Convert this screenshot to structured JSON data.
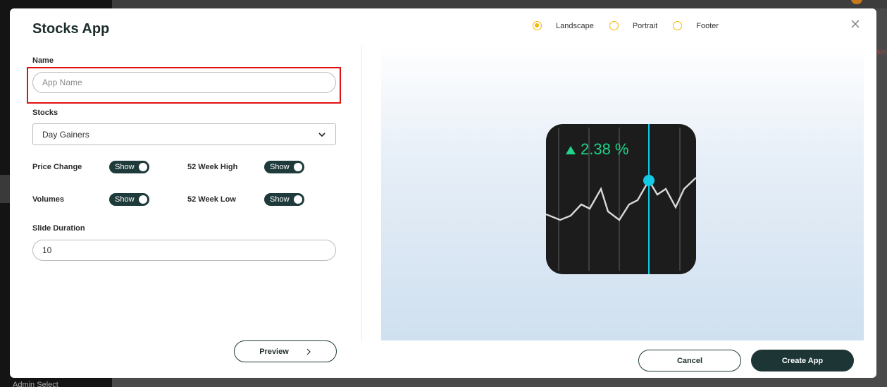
{
  "backdrop": {
    "right_text": "sin",
    "bottom_text": "Admin Select"
  },
  "modal": {
    "title": "Stocks App",
    "orientation": {
      "options": [
        {
          "label": "Landscape",
          "selected": true
        },
        {
          "label": "Portrait",
          "selected": false
        },
        {
          "label": "Footer",
          "selected": false
        }
      ]
    },
    "close_icon": "close-icon"
  },
  "form": {
    "name_label": "Name",
    "name_value": "",
    "name_placeholder": "App Name",
    "stocks_label": "Stocks",
    "stocks_selected": "Day Gainers",
    "price_change_label": "Price Change",
    "price_change_toggle": "Show",
    "week_high_label": "52 Week High",
    "week_high_toggle": "Show",
    "volumes_label": "Volumes",
    "volumes_toggle": "Show",
    "week_low_label": "52 Week Low",
    "week_low_toggle": "Show",
    "slide_duration_label": "Slide Duration",
    "slide_duration_value": "10"
  },
  "preview": {
    "widget_change": "2.38 %",
    "colors": {
      "widget_bg": "#1c1c1c",
      "positive": "#1fd38a",
      "cursor": "#12c9e6"
    }
  },
  "buttons": {
    "preview_label": "Preview",
    "cancel_label": "Cancel",
    "create_label": "Create App"
  },
  "colors": {
    "accent_dark": "#1d3535",
    "radio": "#f2b700",
    "highlight": "#e01010"
  }
}
